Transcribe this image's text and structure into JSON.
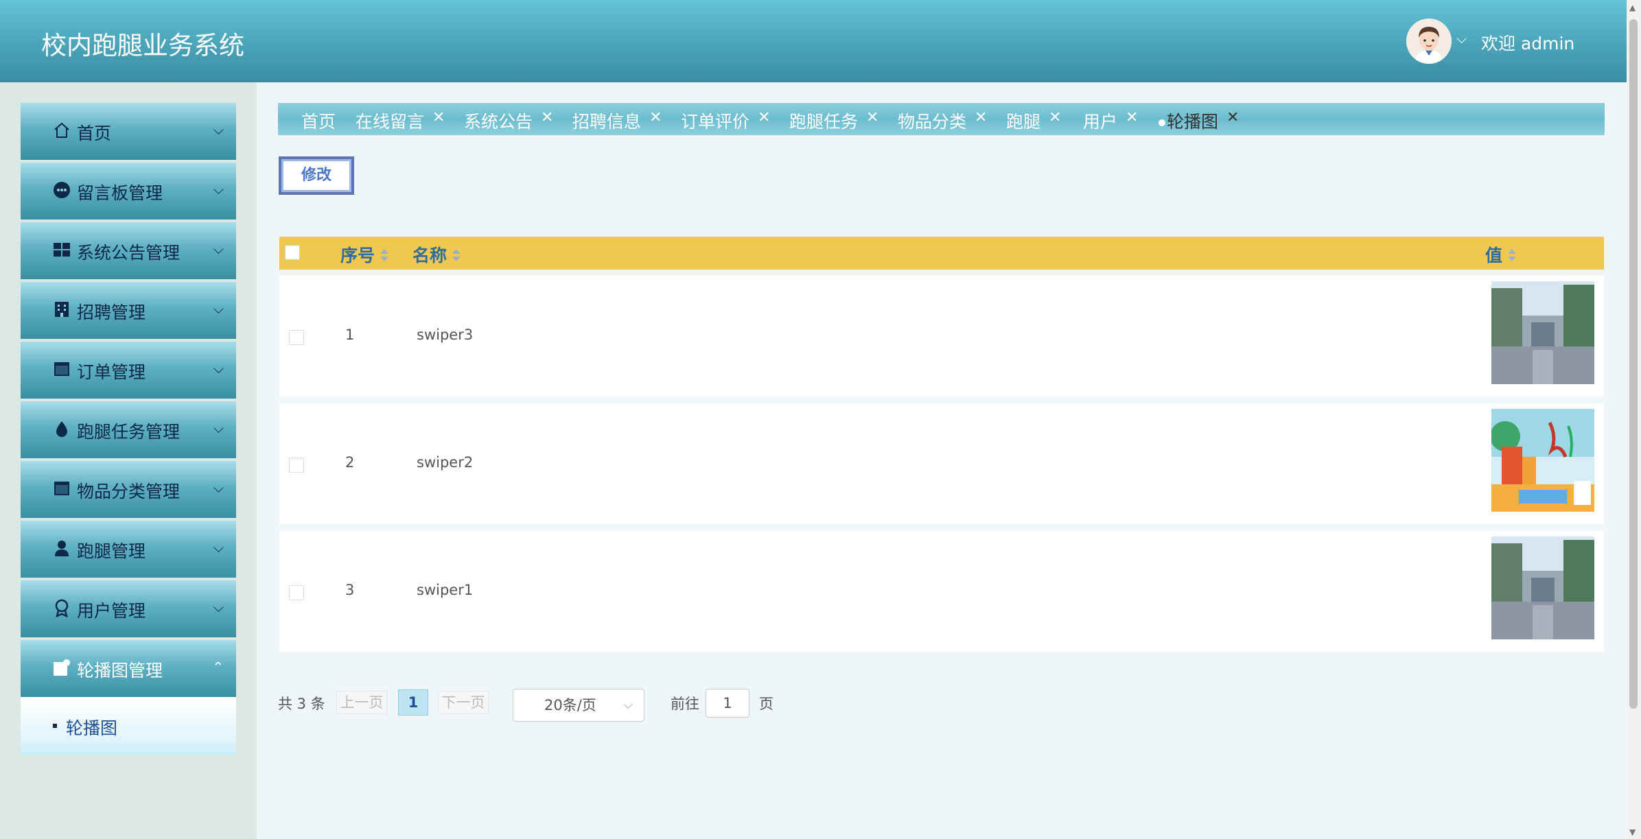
{
  "header": {
    "title": "校内跑腿业务系统",
    "welcome": "欢迎 admin",
    "caret": "⌵"
  },
  "sidebar": {
    "items": [
      {
        "label": "首页",
        "icon": "home-icon",
        "chevron": "⌵"
      },
      {
        "label": "留言板管理",
        "icon": "message-icon",
        "chevron": "⌵"
      },
      {
        "label": "系统公告管理",
        "icon": "grid-icon",
        "chevron": "⌵"
      },
      {
        "label": "招聘管理",
        "icon": "building-icon",
        "chevron": "⌵"
      },
      {
        "label": "订单管理",
        "icon": "window-icon",
        "chevron": "⌵"
      },
      {
        "label": "跑腿任务管理",
        "icon": "drop-icon",
        "chevron": "⌵"
      },
      {
        "label": "物品分类管理",
        "icon": "window-icon",
        "chevron": "⌵"
      },
      {
        "label": "跑腿管理",
        "icon": "person-icon",
        "chevron": "⌵"
      },
      {
        "label": "用户管理",
        "icon": "award-icon",
        "chevron": "⌵"
      },
      {
        "label": "轮播图管理",
        "icon": "image-icon",
        "chevron": "⌃"
      }
    ],
    "subitem": "轮播图"
  },
  "tabs": [
    {
      "label": "首页",
      "closable": false
    },
    {
      "label": "在线留言",
      "closable": true
    },
    {
      "label": "系统公告",
      "closable": true
    },
    {
      "label": "招聘信息",
      "closable": true
    },
    {
      "label": "订单评价",
      "closable": true
    },
    {
      "label": "跑腿任务",
      "closable": true
    },
    {
      "label": "物品分类",
      "closable": true
    },
    {
      "label": "跑腿",
      "closable": true
    },
    {
      "label": "用户",
      "closable": true
    },
    {
      "label": "轮播图",
      "closable": true,
      "active": true
    }
  ],
  "tab_close": "✕",
  "toolbar": {
    "edit_label": "修改"
  },
  "table": {
    "columns": [
      "序号",
      "名称",
      "值"
    ],
    "rows": [
      {
        "index": "1",
        "name": "swiper3",
        "image": "campus-gate"
      },
      {
        "index": "2",
        "name": "swiper2",
        "image": "youth-poster"
      },
      {
        "index": "3",
        "name": "swiper1",
        "image": "campus-gate"
      }
    ]
  },
  "pagination": {
    "total": "共 3 条",
    "prev": "上一页",
    "current": "1",
    "next": "下一页",
    "page_size": "20条/页",
    "size_chevron": "⌵",
    "goto_label": "前往",
    "goto_value": "1",
    "goto_unit": "页"
  },
  "colors": {
    "header": "#4aa4b9",
    "table_header": "#f0c850",
    "menu_text": "#0e2848",
    "accent_blue": "#1d4f9a"
  }
}
